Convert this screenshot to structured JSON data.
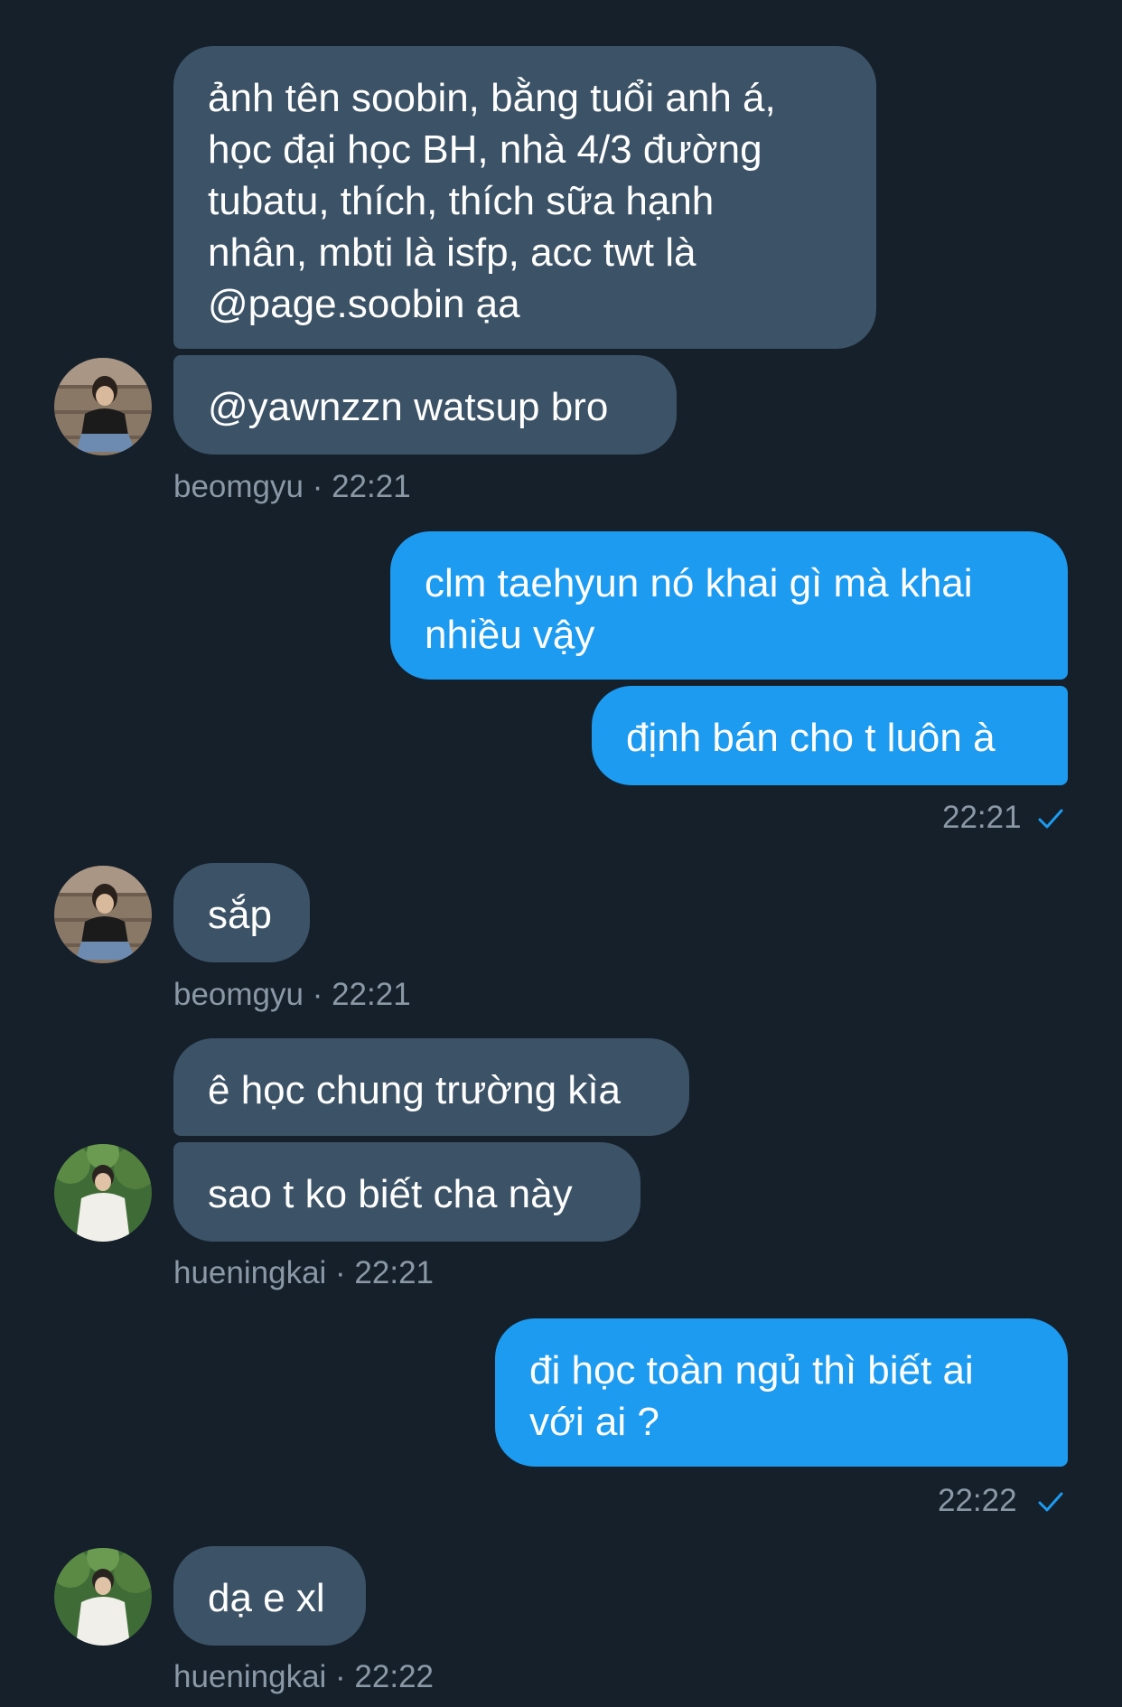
{
  "messages": [
    {
      "side": "in",
      "text": "ảnh tên soobin, bằng tuổi anh á,\nhọc đại học BH, nhà 4/3 đường\ntubatu, thích, thích sữa hạnh\nnhân, mbti là isfp, acc twt là\n@page.soobin ạa"
    },
    {
      "side": "in",
      "text": "@yawnzzn watsup bro"
    },
    {
      "side": "out",
      "text": "clm taehyun nó khai gì mà khai\nnhiều vậy"
    },
    {
      "side": "out",
      "text": "định bán cho t luôn à"
    },
    {
      "side": "in",
      "text": "sắp"
    },
    {
      "side": "in",
      "text": "ê học chung trường kìa"
    },
    {
      "side": "in",
      "text": "sao t ko biết cha này"
    },
    {
      "side": "out",
      "text": "đi học toàn ngủ thì biết ai\nvới ai ?"
    },
    {
      "side": "in",
      "text": "dạ e xl"
    }
  ],
  "meta": {
    "m1": "beomgyu · 22:21",
    "m2": "22:21",
    "m3": "beomgyu · 22:21",
    "m4": "hueningkai · 22:21",
    "m5": "22:22",
    "m6": "hueningkai · 22:22"
  },
  "senders": {
    "beomgyu": "beomgyu",
    "hueningkai": "hueningkai"
  },
  "colors": {
    "background": "#15202b",
    "incoming_bubble": "#3c5266",
    "outgoing_bubble": "#1d9bf0",
    "meta_text": "#8b98a5",
    "read_check": "#1d9bf0"
  },
  "icons": {
    "read_receipt": "checkmark-icon",
    "avatar": "avatar"
  }
}
